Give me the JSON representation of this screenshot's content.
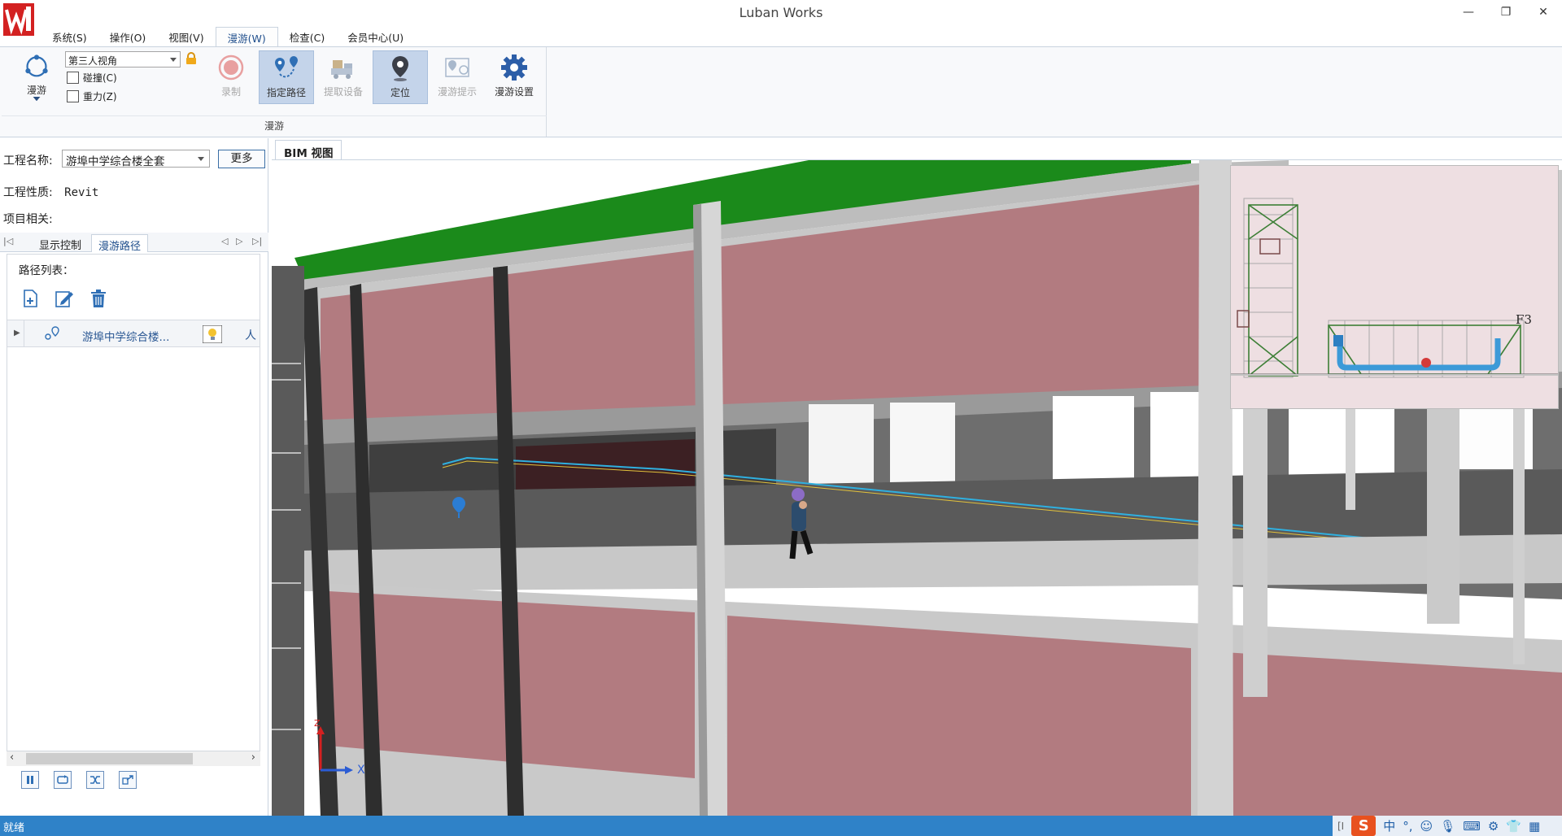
{
  "app": {
    "title": "Luban Works"
  },
  "window_controls": {
    "minimize": "—",
    "restore": "❐",
    "close": "✕"
  },
  "menu": {
    "items": [
      {
        "label": "系统(S)"
      },
      {
        "label": "操作(O)"
      },
      {
        "label": "视图(V)"
      },
      {
        "label": "漫游(W)",
        "active": true
      },
      {
        "label": "检查(C)"
      },
      {
        "label": "会员中心(U)"
      }
    ]
  },
  "ribbon": {
    "roam_label": "漫游",
    "view_mode": "第三人视角",
    "collision_label": "碰撞(C)",
    "gravity_label": "重力(Z)",
    "record_label": "录制",
    "assign_path_label": "指定路径",
    "extract_device_label": "提取设备",
    "locate_label": "定位",
    "roam_tips_label": "漫游提示",
    "roam_settings_label": "漫游设置",
    "group_label": "漫游"
  },
  "left_panel": {
    "project_name_label": "工程名称:",
    "project_name_value": "游埠中学综合楼全套",
    "more_button": "更多",
    "project_nature_label": "工程性质:",
    "project_nature_value": "Revit",
    "project_related_label": "项目相关:",
    "tabs": [
      {
        "label": "显示控制"
      },
      {
        "label": "漫游路径",
        "active": true
      }
    ],
    "path_list_label": "路径列表：",
    "path_row": {
      "name": "游埠中学综合楼...",
      "extra": "人"
    }
  },
  "document": {
    "tab_label": "BIM 视图"
  },
  "minimap": {
    "floor_label": "F3"
  },
  "axis": {
    "x_label": "X",
    "z_label": "Z"
  },
  "status": {
    "text": "就绪"
  },
  "tray": {
    "ime_logo": "S",
    "ime_lang": "中",
    "punct": "°,",
    "prefix": "[I"
  },
  "colors": {
    "accent": "#2f82c8",
    "roof_green": "#1b8a1b",
    "wall_pink": "#b07a80",
    "path_blue": "#2f9ad8"
  }
}
